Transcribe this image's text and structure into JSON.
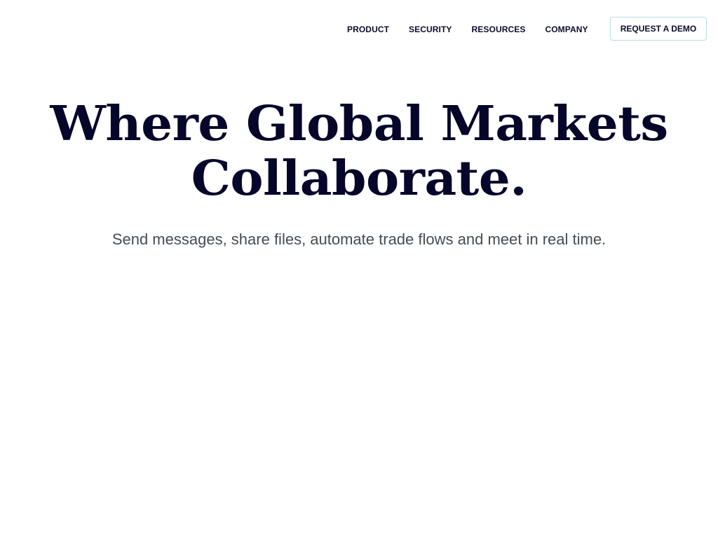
{
  "nav": {
    "items": [
      {
        "label": "PRODUCT"
      },
      {
        "label": "SECURITY"
      },
      {
        "label": "RESOURCES"
      },
      {
        "label": "COMPANY"
      }
    ],
    "cta_label": "REQUEST A DEMO"
  },
  "hero": {
    "title_line_1": "Where Global Markets",
    "title_line_2": "Collaborate.",
    "subtitle": "Send messages, share files, automate trade flows and meet in real time."
  },
  "colors": {
    "heading": "#06052a",
    "nav_text": "#0d0c2b",
    "subtitle": "#454b57",
    "button_border": "#b8dce6",
    "background": "#ffffff"
  }
}
